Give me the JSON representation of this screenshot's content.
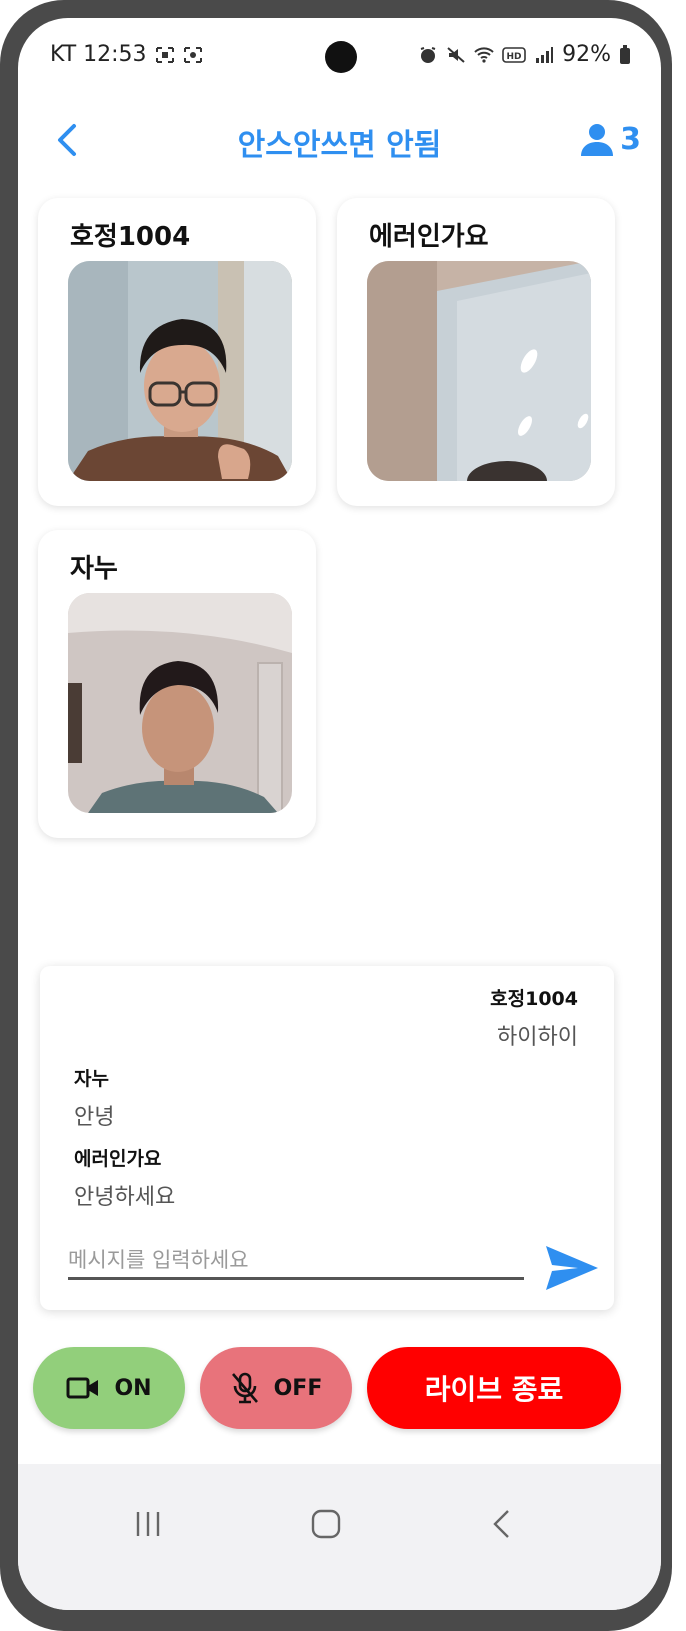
{
  "status_bar": {
    "carrier_time": "KT 12:53",
    "battery": "92%"
  },
  "header": {
    "title": "안스안쓰면 안됨",
    "participant_count": "3"
  },
  "participants": [
    {
      "name": "호정1004"
    },
    {
      "name": "에러인가요"
    },
    {
      "name": "자누"
    }
  ],
  "chat": {
    "messages": [
      {
        "sender": "호정1004",
        "text": "하이하이",
        "align": "right"
      },
      {
        "sender": "자누",
        "text": "안녕",
        "align": "left"
      },
      {
        "sender": "에러인가요",
        "text": "안녕하세요",
        "align": "left"
      }
    ],
    "input_placeholder": "메시지를 입력하세요"
  },
  "controls": {
    "camera_label": "ON",
    "mic_label": "OFF",
    "end_label": "라이브 종료"
  },
  "colors": {
    "accent": "#2f8ff0",
    "camera_on": "#92cf7b",
    "mic_off": "#e8737b",
    "end_live": "#ff0000"
  }
}
